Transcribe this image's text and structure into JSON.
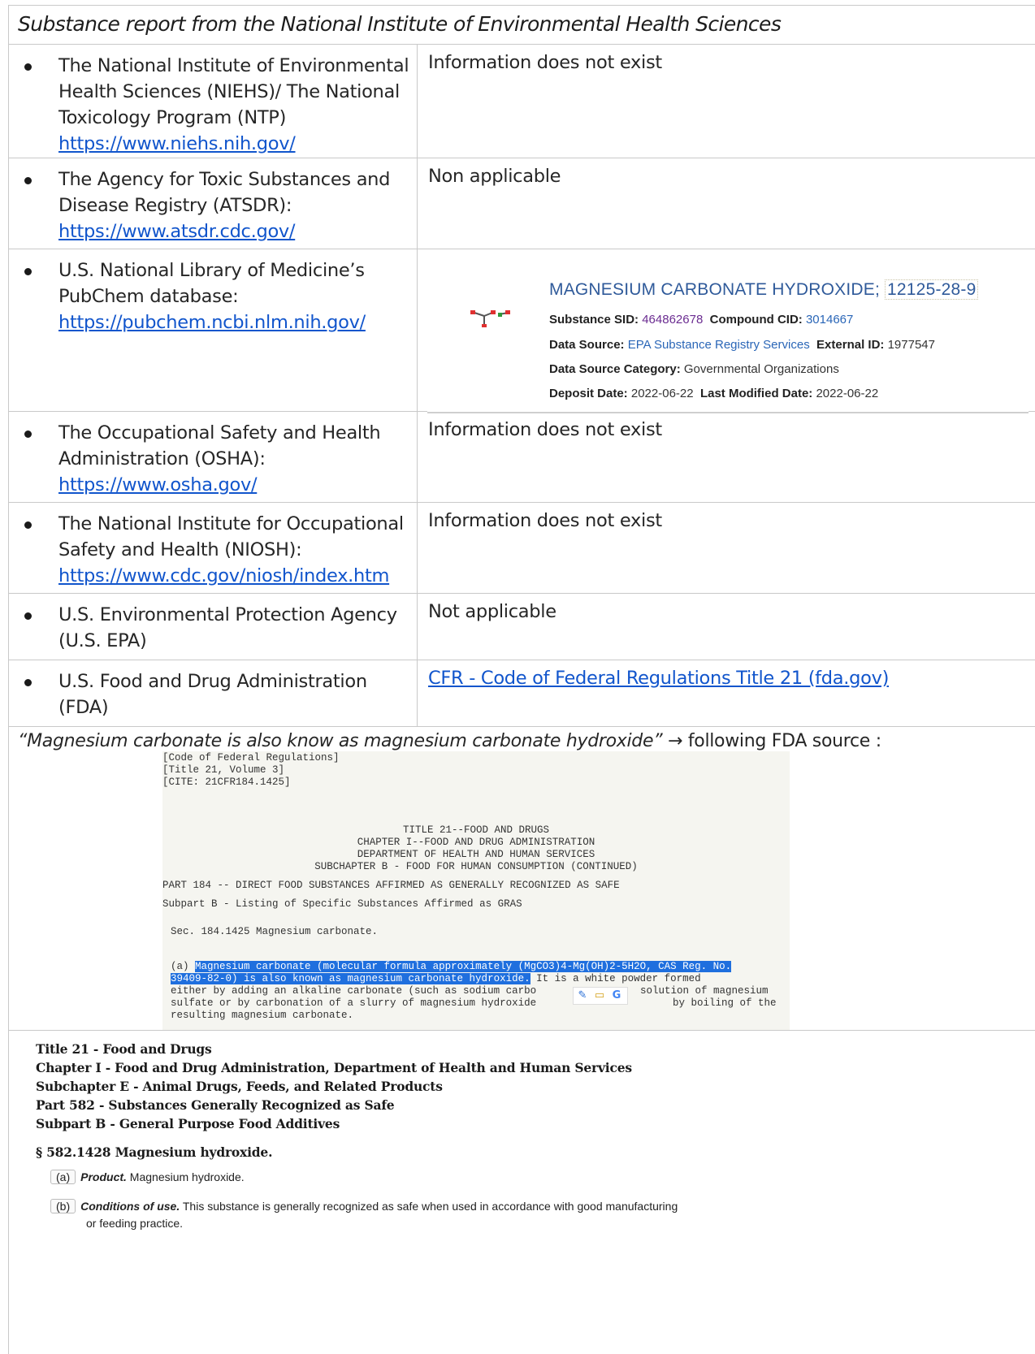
{
  "header": {
    "title": "Substance report from the National Institute of Environmental Health Sciences"
  },
  "rows": [
    {
      "lines": [
        "The National Institute of Environmental",
        "Health Sciences (NIEHS)/ The National",
        "Toxicology Program (NTP)"
      ],
      "url": "https://www.niehs.nih.gov/",
      "right": "Information does not exist"
    },
    {
      "lines": [
        "The Agency for Toxic Substances and",
        "Disease Registry (ATSDR):"
      ],
      "url": "https://www.atsdr.cdc.gov/",
      "right": "Non applicable"
    },
    {
      "lines": [
        "U.S. National Library of Medicine’s",
        "PubChem database:"
      ],
      "url": "https://pubchem.ncbi.nlm.nih.gov/",
      "right": ""
    },
    {
      "lines": [
        "The Occupational Safety and Health",
        "Administration (OSHA):"
      ],
      "url": "https://www.osha.gov/",
      "right": "Information does not exist"
    },
    {
      "lines": [
        "The National Institute for Occupational",
        "Safety and Health (NIOSH):"
      ],
      "url": "https://www.cdc.gov/niosh/index.htm",
      "right": "Information does not exist"
    },
    {
      "lines": [
        "U.S. Environmental Protection Agency",
        "(U.S. EPA)"
      ],
      "url": "",
      "right": "Not applicable"
    },
    {
      "lines": [
        "U.S. Food and Drug Administration",
        "(FDA)"
      ],
      "url": "",
      "right": "CFR - Code of Federal Regulations Title 21 (fda.gov)"
    }
  ],
  "pubchem": {
    "title": "MAGNESIUM CARBONATE HYDROXIDE;",
    "cas": "12125-28-9",
    "sid_label": "Substance SID:",
    "sid": "464862678",
    "cid_label": "Compound CID:",
    "cid": "3014667",
    "source_label": "Data Source:",
    "source": "EPA Substance Registry Services",
    "ext_label": "External ID:",
    "ext": "1977547",
    "cat_label": "Data Source Category:",
    "cat": "Governmental Organizations",
    "dep_label": "Deposit Date:",
    "dep": "2022-06-22",
    "mod_label": "Last Modified Date:",
    "mod": "2022-06-22"
  },
  "quote": {
    "italic": "“Magnesium carbonate is also know as magnesium carbonate hydroxide”",
    "rest": " → following FDA source :"
  },
  "cfr": {
    "l1": "[Code of Federal Regulations]",
    "l2": "[Title 21, Volume 3]",
    "l3": "[CITE: 21CFR184.1425]",
    "c1": "TITLE 21--FOOD AND DRUGS",
    "c2": "CHAPTER I--FOOD AND DRUG ADMINISTRATION",
    "c3": "DEPARTMENT OF HEALTH AND HUMAN SERVICES",
    "c4": "SUBCHAPTER B - FOOD FOR HUMAN CONSUMPTION (CONTINUED)",
    "part": "PART 184 -- DIRECT FOOD SUBSTANCES AFFIRMED AS GENERALLY RECOGNIZED AS SAFE",
    "subpart": "Subpart B - Listing of Specific Substances Affirmed as GRAS",
    "sec": "Sec. 184.1425 Magnesium carbonate.",
    "a_tag": "(a) ",
    "a_hl1": "Magnesium carbonate (molecular formula approximately (MgCO3)4-Mg(OH)2-5H2O, CAS Reg. No.",
    "a_hl2": "39409-82-0) is also known as magnesium carbonate hydroxide.",
    "a_rest2": " It is a white powder formed",
    "a_l3a": "either by adding an alkaline carbonate (such as sodium carbo",
    "a_l3b": "solution of magnesium",
    "a_l4a": "sulfate or by carbonation of a slurry of magnesium hydroxide",
    "a_l4b": "by boiling of the",
    "a_l5": "resulting magnesium carbonate."
  },
  "ecfr": {
    "h1": "Title 21 - Food and Drugs",
    "h2": "Chapter I - Food and Drug Administration, Department of Health and Human Services",
    "h3": "Subchapter E - Animal Drugs, Feeds, and Related Products",
    "h4": "Part 582 - Substances Generally Recognized as Safe",
    "h5": "Subpart B - General Purpose Food Additives",
    "sec": "§ 582.1428 Magnesium hydroxide.",
    "a_tag": "(a)",
    "a_label": "Product.",
    "a_text": " Magnesium hydroxide.",
    "b_tag": "(b)",
    "b_label": "Conditions of use.",
    "b_text": " This substance is generally recognized as safe when used in accordance with good manufacturing",
    "b_text2": "or feeding practice."
  }
}
